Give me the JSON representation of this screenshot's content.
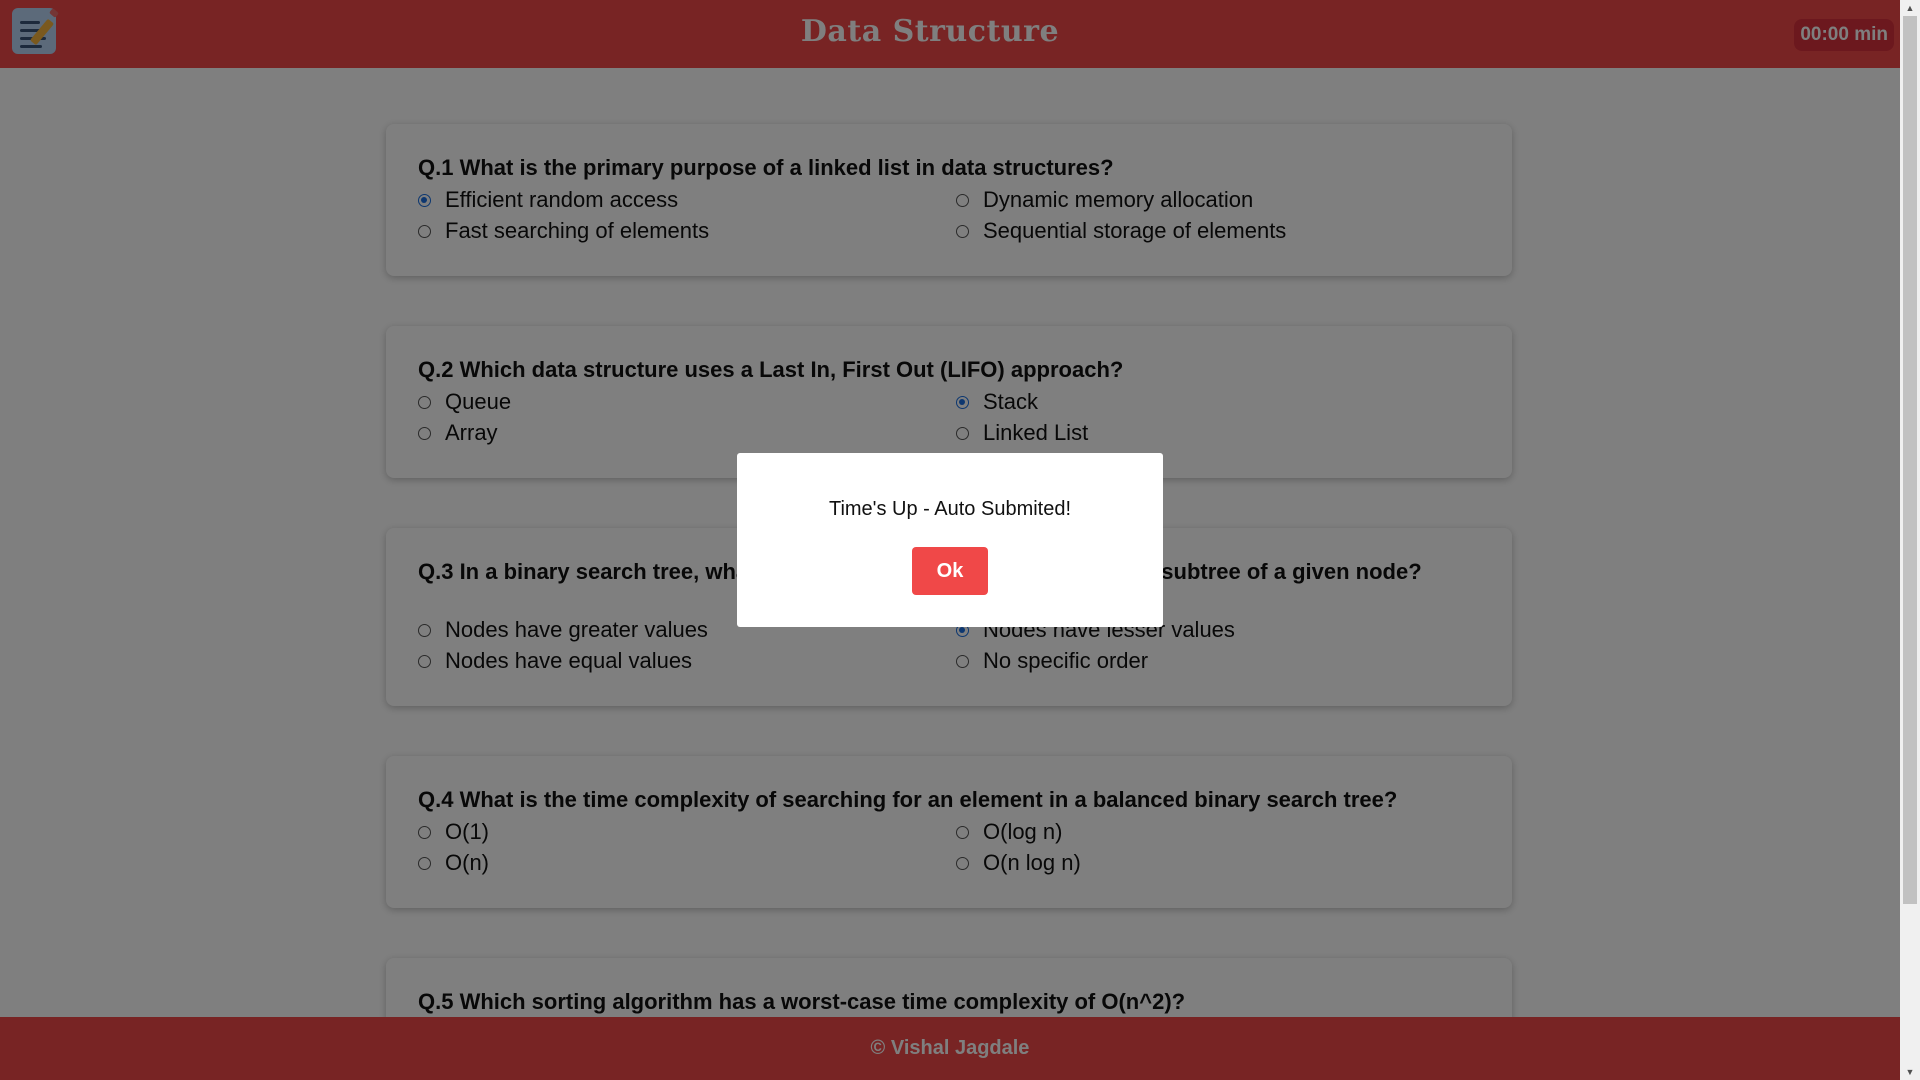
{
  "header": {
    "title": "Data Structure",
    "timer": "00:00 min",
    "background_color": "#f04848"
  },
  "questions": [
    {
      "text": "Q.1 What is the primary purpose of a linked list in data structures?",
      "options": [
        {
          "label": "Efficient random access",
          "selected": true
        },
        {
          "label": "Dynamic memory allocation",
          "selected": false
        },
        {
          "label": "Fast searching of elements",
          "selected": false
        },
        {
          "label": "Sequential storage of elements",
          "selected": false
        }
      ]
    },
    {
      "text": "Q.2 Which data structure uses a Last In, First Out (LIFO) approach?",
      "options": [
        {
          "label": "Queue",
          "selected": false
        },
        {
          "label": "Stack",
          "selected": true
        },
        {
          "label": "Array",
          "selected": false
        },
        {
          "label": "Linked List",
          "selected": false
        }
      ]
    },
    {
      "text": "Q.3 In a binary search tree, what is the property of the nodes in the left subtree of a given node?",
      "options": [
        {
          "label": "Nodes have greater values",
          "selected": false
        },
        {
          "label": "Nodes have lesser values",
          "selected": true
        },
        {
          "label": "Nodes have equal values",
          "selected": false
        },
        {
          "label": "No specific order",
          "selected": false
        }
      ]
    },
    {
      "text": "Q.4 What is the time complexity of searching for an element in a balanced binary search tree?",
      "options": [
        {
          "label": "O(1)",
          "selected": false
        },
        {
          "label": "O(log n)",
          "selected": false
        },
        {
          "label": "O(n)",
          "selected": false
        },
        {
          "label": "O(n log n)",
          "selected": false
        }
      ]
    },
    {
      "text": "Q.5 Which sorting algorithm has a worst-case time complexity of O(n^2)?",
      "options": []
    }
  ],
  "modal": {
    "message": "Time's Up - Auto Submited!",
    "ok_label": "Ok",
    "button_color": "#f04848"
  },
  "footer": {
    "text": "© Vishal Jagdale"
  },
  "icons": {
    "menu": "notes-pencil-icon",
    "scroll_up": "scroll-up-arrow-icon",
    "scroll_down": "scroll-down-arrow-icon"
  }
}
